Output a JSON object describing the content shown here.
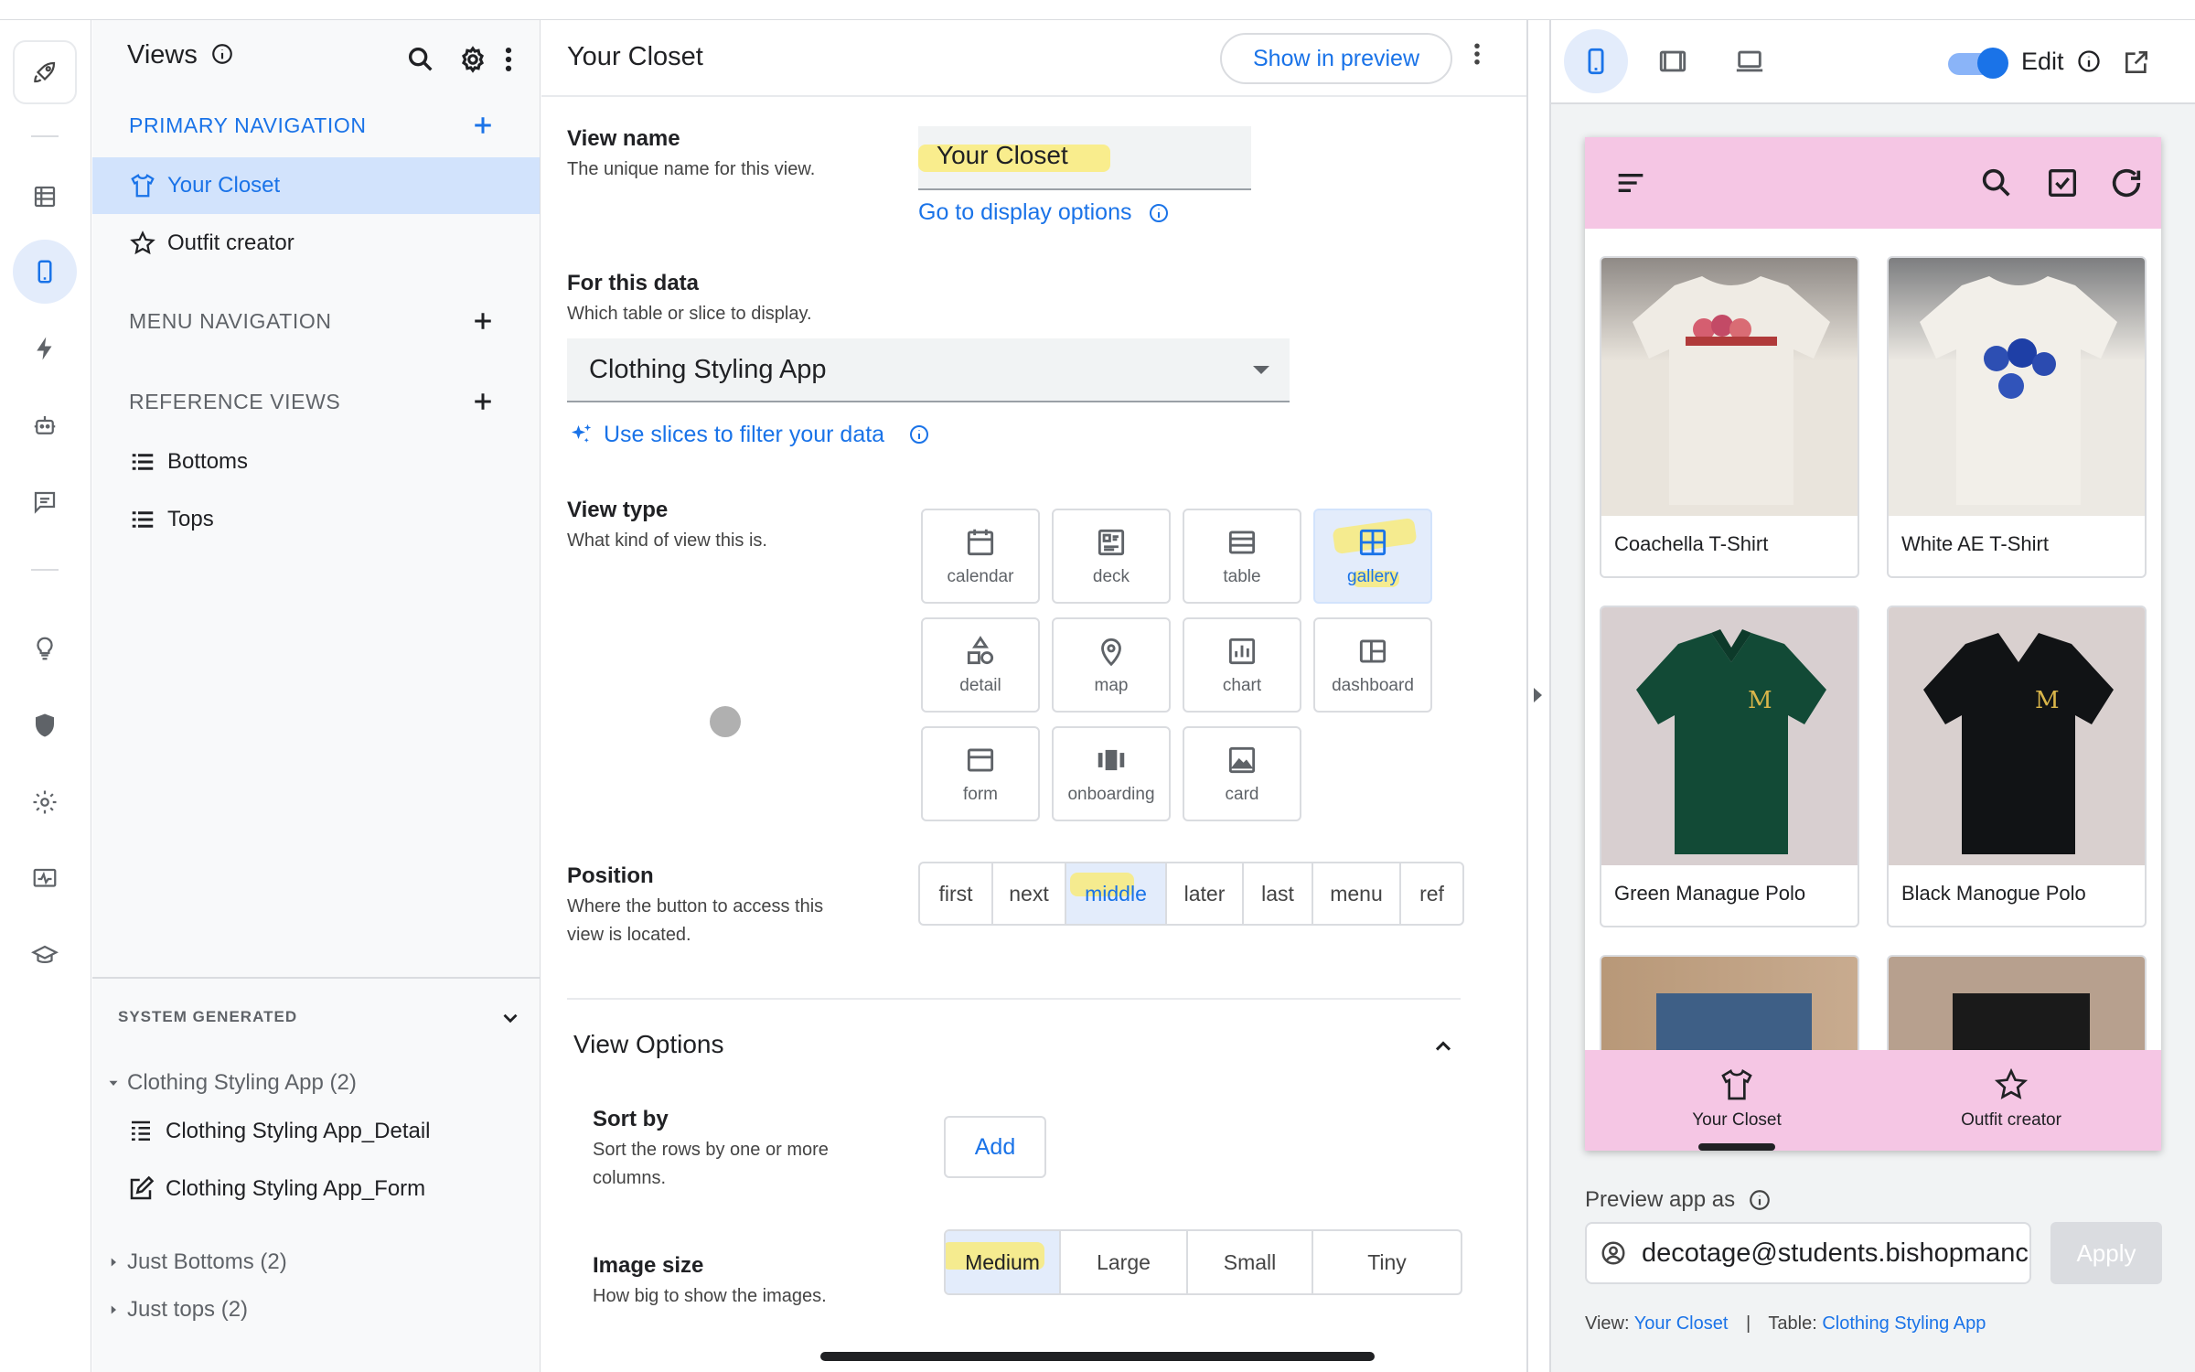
{
  "views_panel": {
    "title": "Views",
    "primary_navigation": "PRIMARY NAVIGATION",
    "primary_items": [
      "Your Closet",
      "Outfit creator"
    ],
    "menu_navigation": "MENU NAVIGATION",
    "reference_views": "REFERENCE VIEWS",
    "reference_items": [
      "Bottoms",
      "Tops"
    ],
    "system_generated": "SYSTEM GENERATED",
    "tree": {
      "group1": "Clothing Styling App (2)",
      "group1_children": [
        "Clothing Styling App_Detail",
        "Clothing Styling App_Form"
      ],
      "group2": "Just Bottoms (2)",
      "group3": "Just tops (2)"
    }
  },
  "editor": {
    "title": "Your Closet",
    "show_in_preview": "Show in preview",
    "view_name_label": "View name",
    "view_name_desc": "The unique name for this view.",
    "view_name_value": "Your Closet",
    "display_options_link": "Go to display options",
    "for_this_data_label": "For this data",
    "for_this_data_desc": "Which table or slice to display.",
    "data_value": "Clothing Styling App",
    "slices_link": "Use slices to filter your data",
    "view_type_label": "View type",
    "view_type_desc": "What kind of view this is.",
    "view_types": [
      "calendar",
      "deck",
      "table",
      "gallery",
      "detail",
      "map",
      "chart",
      "dashboard",
      "form",
      "onboarding",
      "card"
    ],
    "view_type_selected": "gallery",
    "position_label": "Position",
    "position_desc_1": "Where the button to access this",
    "position_desc_2": "view is located.",
    "positions": [
      "first",
      "next",
      "middle",
      "later",
      "last",
      "menu",
      "ref"
    ],
    "position_selected": "middle",
    "view_options_title": "View Options",
    "sort_by_label": "Sort by",
    "sort_by_desc_1": "Sort the rows by one or more",
    "sort_by_desc_2": "columns.",
    "add_label": "Add",
    "image_size_label": "Image size",
    "image_size_desc": "How big to show the images.",
    "image_sizes": [
      "Medium",
      "Large",
      "Small",
      "Tiny"
    ],
    "image_size_selected": "Medium"
  },
  "preview": {
    "edit_label": "Edit",
    "edit_enabled": true,
    "cards": [
      {
        "caption": "Coachella T-Shirt",
        "colors": [
          "#8f8a86",
          "#e9e4dc"
        ]
      },
      {
        "caption": "White AE T-Shirt",
        "colors": [
          "#7d7e80",
          "#ece9e3"
        ]
      },
      {
        "caption": "Green Manague Polo",
        "colors": [
          "#d8cfd0",
          "#124a36"
        ]
      },
      {
        "caption": "Black Manogue Polo",
        "colors": [
          "#d9d0cf",
          "#111315"
        ]
      },
      {
        "caption": "",
        "colors": [
          "#b89878",
          "#3e5f86"
        ]
      },
      {
        "caption": "",
        "colors": [
          "#b7a08e",
          "#1a1a1a"
        ]
      }
    ],
    "bottom_nav": [
      "Your Closet",
      "Outfit creator"
    ],
    "preview_as_label": "Preview app as",
    "preview_as_value": "decotage@students.bishopmanc",
    "apply_label": "Apply",
    "footer_view_prefix": "View:",
    "footer_view": "Your Closet",
    "footer_sep": "|",
    "footer_table_prefix": "Table:",
    "footer_table": "Clothing Styling App",
    "app_bar_color": "#f5c6e4",
    "accent": "#1a73e8"
  }
}
